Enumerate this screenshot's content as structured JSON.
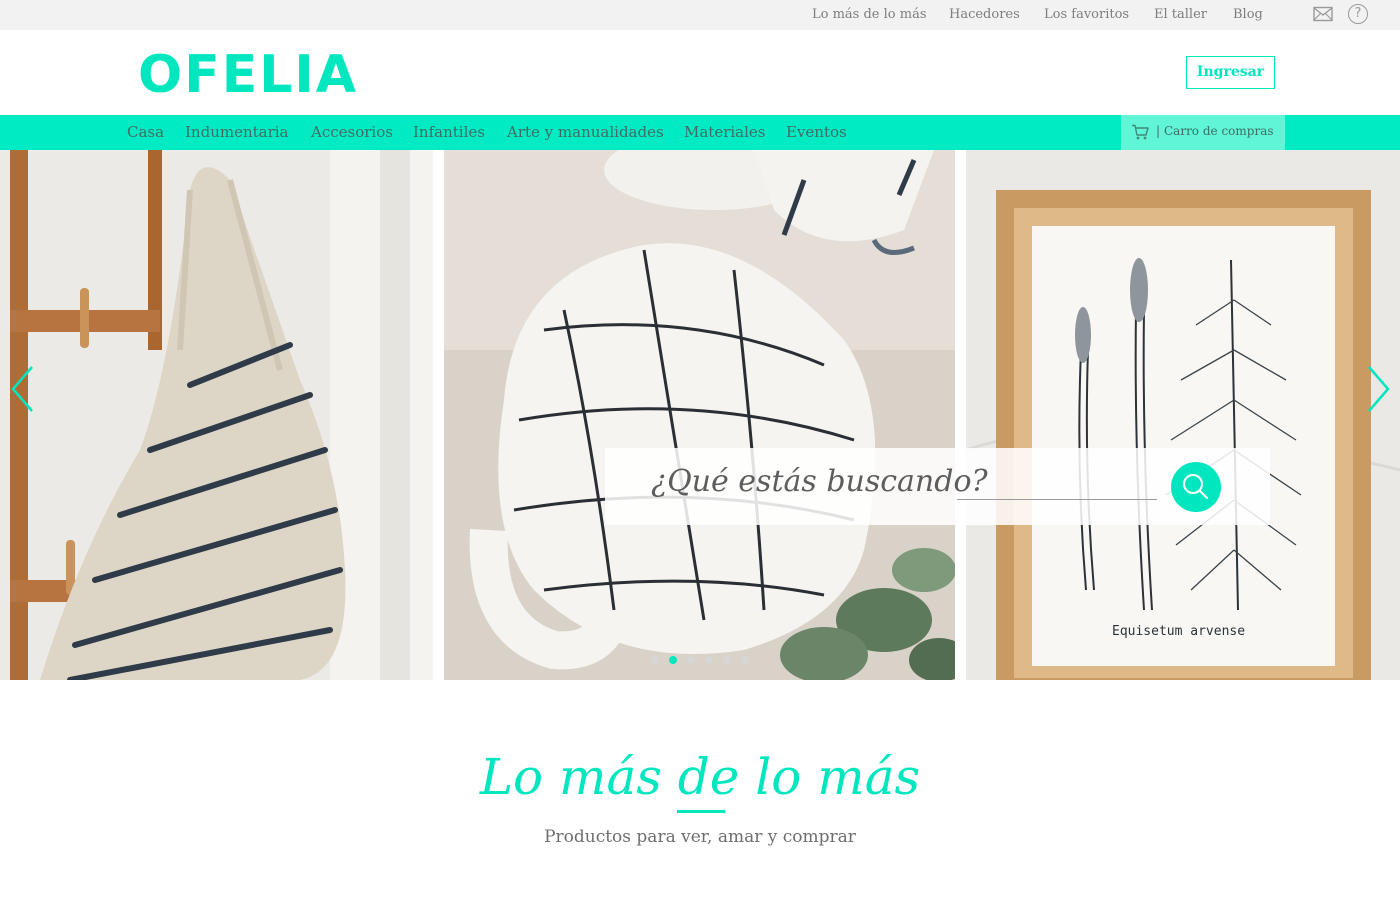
{
  "top_nav": {
    "links": [
      "Lo más de lo más",
      "Hacedores",
      "Los favoritos",
      "El taller",
      "Blog"
    ],
    "mail_icon": "mail-icon",
    "help_icon": "help-icon",
    "help_glyph": "?"
  },
  "header": {
    "logo_text": "OFELIA",
    "login_label": "Ingresar"
  },
  "category_nav": {
    "items": [
      "Casa",
      "Indumentaria",
      "Accesorios",
      "Infantiles",
      "Arte y manualidades",
      "Materiales",
      "Eventos"
    ],
    "cart_separator": "|",
    "cart_label": "Carro de compras",
    "cart_icon": "cart-icon"
  },
  "carousel": {
    "slides": [
      "woven-bag-photo",
      "ceramic-mugs-photo",
      "framed-botanical-print-photo"
    ],
    "print_caption": "Equisetum arvense",
    "prev_icon": "chevron-left-icon",
    "next_icon": "chevron-right-icon",
    "dot_count": 6,
    "active_dot_index": 1
  },
  "search": {
    "label": "¿Qué estás buscando?",
    "value": "",
    "placeholder": "",
    "button_icon": "search-icon"
  },
  "section": {
    "title": "Lo más de lo más",
    "subtitle": "Productos para ver, amar y comprar"
  },
  "colors": {
    "accent": "#00e6bf",
    "nav_bar": "#00ebc4",
    "cart_bg": "#5ff5d6",
    "topbar_bg": "#f2f2f2"
  }
}
